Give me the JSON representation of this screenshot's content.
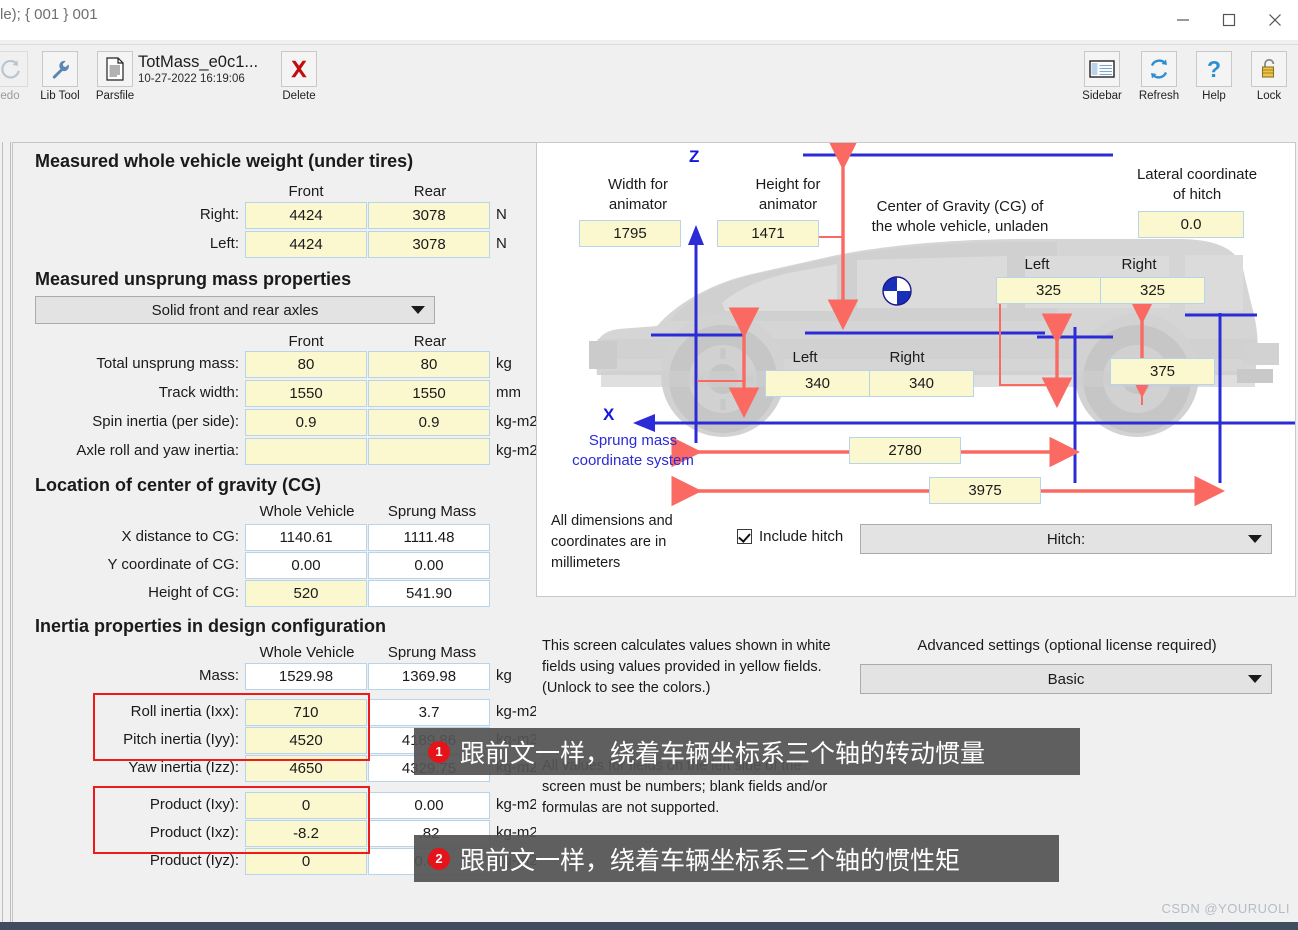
{
  "window": {
    "title": "le); { 001 } 001",
    "controls": {
      "minimize": "minimize-icon",
      "maximize": "maximize-icon",
      "close": "close-icon"
    }
  },
  "toolbar": {
    "items": [
      {
        "label": "edo",
        "icon": "redo-icon",
        "disabled": true
      },
      {
        "label": "Lib Tool",
        "icon": "wrench-icon",
        "disabled": false
      },
      {
        "label": "Parsfile",
        "icon": "document-icon",
        "disabled": false
      },
      {
        "label": "Delete",
        "icon": "red-x-icon",
        "disabled": false
      }
    ],
    "parsfile": {
      "name": "TotMass_e0c1...",
      "date": "10-27-2022 16:19:06"
    },
    "right_items": [
      {
        "label": "Sidebar",
        "icon": "sidebar-icon"
      },
      {
        "label": "Refresh",
        "icon": "refresh-icon"
      },
      {
        "label": "Help",
        "icon": "question-icon"
      },
      {
        "label": "Lock",
        "icon": "padlock-icon"
      }
    ]
  },
  "left": {
    "section1": {
      "title": "Measured whole vehicle weight (under tires)",
      "col_front": "Front",
      "col_rear": "Rear",
      "rows": [
        {
          "label": "Right:",
          "front": "4424",
          "rear": "3078",
          "unit": "N"
        },
        {
          "label": "Left:",
          "front": "4424",
          "rear": "3078",
          "unit": "N"
        }
      ]
    },
    "section2": {
      "title": "Measured unsprung mass properties",
      "dropdown": "Solid front and rear axles",
      "col_front": "Front",
      "col_rear": "Rear",
      "rows": [
        {
          "label": "Total unsprung mass:",
          "front": "80",
          "rear": "80",
          "unit": "kg"
        },
        {
          "label": "Track width:",
          "front": "1550",
          "rear": "1550",
          "unit": "mm"
        },
        {
          "label": "Spin inertia (per side):",
          "front": "0.9",
          "rear": "0.9",
          "unit": "kg-m2"
        },
        {
          "label": "Axle roll and yaw inertia:",
          "front": "",
          "rear": "",
          "unit": "kg-m2"
        }
      ]
    },
    "section3": {
      "title": "Location of center of gravity (CG)",
      "col_whole": "Whole Vehicle",
      "col_sprung": "Sprung Mass",
      "rows": [
        {
          "label": "X distance  to CG:",
          "whole": "1140.61",
          "sprung": "1111.48",
          "whole_yellow": false
        },
        {
          "label": "Y coordinate of CG:",
          "whole": "0.00",
          "sprung": "0.00",
          "whole_yellow": false
        },
        {
          "label": "Height of CG:",
          "whole": "520",
          "sprung": "541.90",
          "whole_yellow": true
        }
      ]
    },
    "section4": {
      "title": "Inertia properties in design configuration",
      "col_whole": "Whole Vehicle",
      "col_sprung": "Sprung Mass",
      "rows": [
        {
          "label": "Mass:",
          "whole": "1529.98",
          "sprung": "1369.98",
          "unit": "kg",
          "whole_yellow": false
        },
        {
          "label": "Roll inertia (Ixx):",
          "whole": "710",
          "sprung": "3.7",
          "unit": "kg-m2",
          "whole_yellow": true
        },
        {
          "label": "Pitch inertia (Iyy):",
          "whole": "4520",
          "sprung": "4189.86",
          "unit": "kg-m2",
          "whole_yellow": true
        },
        {
          "label": "Yaw inertia (Izz):",
          "whole": "4650",
          "sprung": "4329.75",
          "unit": "kg-m2",
          "whole_yellow": true
        },
        {
          "label": "Product (Ixy):",
          "whole": "0",
          "sprung": "0.00",
          "unit": "kg-m2",
          "whole_yellow": true
        },
        {
          "label": "Product (Ixz):",
          "whole": "-8.2",
          "sprung": ".82",
          "unit": "kg-m2",
          "whole_yellow": true
        },
        {
          "label": "Product (Iyz):",
          "whole": "0",
          "sprung": "0.00",
          "unit": "kg-m2",
          "whole_yellow": true
        }
      ]
    }
  },
  "diagram": {
    "width_label": "Width for\nanimator",
    "width_value": "1795",
    "height_label": "Height for\nanimator",
    "height_value": "1471",
    "cg_label": "Center of Gravity (CG) of\nthe whole vehicle, unladen",
    "lateral_hitch_label": "Lateral coordinate\nof hitch",
    "lateral_hitch_value": "0.0",
    "rear_lr": {
      "left_label": "Left",
      "right_label": "Right",
      "left": "325",
      "right": "325"
    },
    "front_lr": {
      "left_label": "Left",
      "right_label": "Right",
      "left": "340",
      "right": "340"
    },
    "hitch_height_value": "375",
    "wheelbase_value": "2780",
    "overall_value": "3975",
    "axis_z": "Z",
    "axis_x": "X",
    "sprung_coord_label": "Sprung mass\ncoordinate system",
    "units_note": "All dimensions and\ncoordinates are in\nmillimeters",
    "include_hitch": "Include hitch",
    "hitch_dropdown": "Hitch:"
  },
  "bottom": {
    "note": "This screen calculates values shown in white fields using values provided in yellow fields. (Unlock to see the colors.)",
    "note2": "All values for fields on the left side of the screen must be numbers; blank fields and/or formulas are not supported.",
    "advanced_label": "Advanced settings (optional license required)",
    "advanced_value": "Basic"
  },
  "annotations": [
    {
      "number": "1",
      "text": "跟前文一样，绕着车辆坐标系三个轴的转动惯量"
    },
    {
      "number": "2",
      "text": "跟前文一样，绕着车辆坐标系三个轴的惯性矩"
    }
  ],
  "watermark": "CSDN @YOURUOLI",
  "colors": {
    "yellow_field": "#fbf8cf",
    "red_highlight": "#ee1b1b",
    "blue_axis": "#1515e0",
    "red_arrow": "#fa6a62"
  }
}
